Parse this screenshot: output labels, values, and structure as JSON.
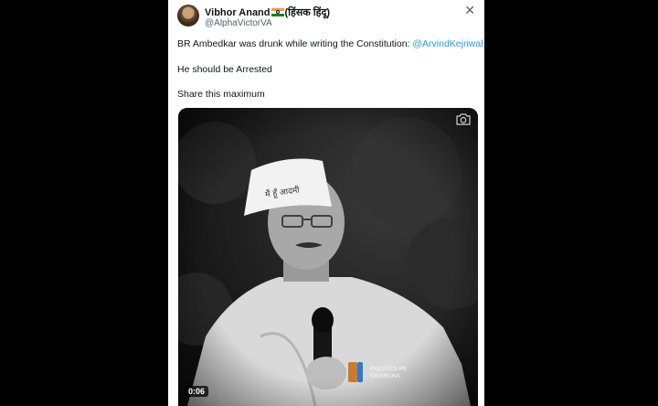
{
  "tweet": {
    "author_name": "Vibhor Anand",
    "author_suffix": "(हिंसक हिंदू)",
    "handle": "@AlphaVictorVA",
    "line1_text": "BR Ambedkar was drunk while writing the Constitution: ",
    "line1_mention": "@ArvindKejriwal",
    "line2": "He should be Arrested",
    "line3": "Share this maximum"
  },
  "media": {
    "duration": "0:06",
    "cap_text": "मैं हूँ आदमी",
    "watermark_line1": "POLITICS PE",
    "watermark_line2": "CHARCHA"
  },
  "colors": {
    "background": "#000000",
    "card": "#ffffff",
    "text": "#0f1419",
    "secondary": "#536471",
    "link": "#1d9bf0"
  },
  "icons": [
    "close-icon",
    "camera-icon",
    "flag-india-icon"
  ]
}
